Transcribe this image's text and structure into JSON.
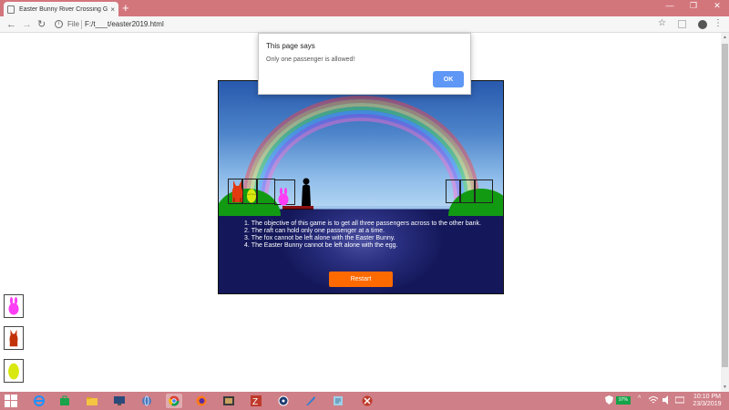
{
  "browser": {
    "tab_title": "Easter Bunny River Crossing Game",
    "tab_close": "×",
    "new_tab": "+",
    "window_controls": {
      "minimize": "—",
      "maximize": "❐",
      "close": "✕"
    },
    "nav": {
      "back": "←",
      "forward": "→",
      "reload": "↻"
    },
    "scheme": "File",
    "url": "F:/t___t/easter2019.html",
    "bookmark": "☆",
    "menu": "⋮"
  },
  "dialog": {
    "title": "This page says",
    "message": "Only one passenger is allowed!",
    "ok_label": "OK"
  },
  "game": {
    "rules": [
      "The objective of this game is to get all three passengers across to the other bank.",
      "The raft can hold only one passenger at a time.",
      "The fox cannot be left alone with the Easter Bunny.",
      "The Easter Bunny cannot be left alone with the egg."
    ],
    "restart_label": "Restart",
    "colors": {
      "bunny": "#ff3df5",
      "fox": "#e23a10",
      "egg": "#d9e80f",
      "restart": "#ff6a00",
      "grass": "#129a12",
      "raft": "#8b1010"
    }
  },
  "side_icons": [
    "bunny-icon",
    "fox-icon",
    "egg-icon"
  ],
  "taskbar": {
    "battery": "97%",
    "time": "10:10 PM",
    "date": "23/3/2019",
    "tray_arrow": "^"
  }
}
